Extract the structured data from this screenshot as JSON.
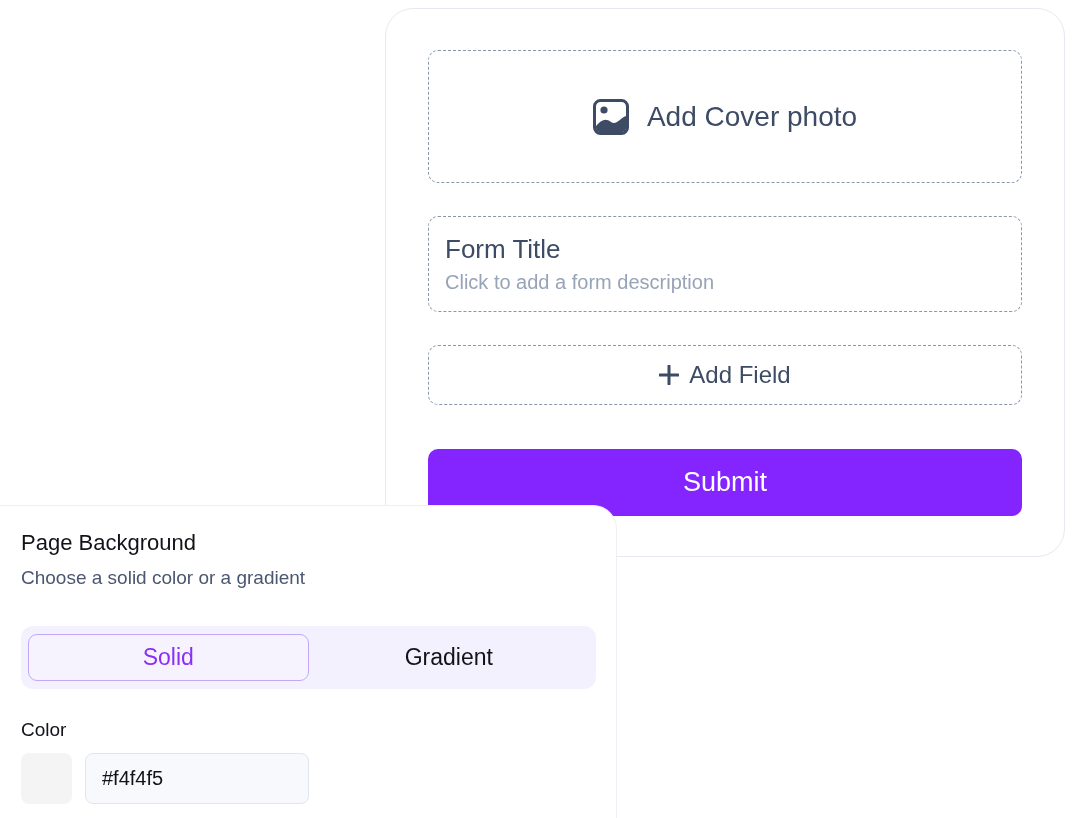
{
  "form": {
    "cover": {
      "label": "Add Cover photo"
    },
    "title": "Form Title",
    "description": {
      "placeholder": "Click to add a form description"
    },
    "add_field": {
      "label": "Add Field"
    },
    "submit": {
      "label": "Submit"
    }
  },
  "background_panel": {
    "title": "Page Background",
    "subtitle": "Choose a solid color or a gradient",
    "tabs": [
      {
        "label": "Solid",
        "selected": true
      },
      {
        "label": "Gradient",
        "selected": false
      }
    ],
    "color": {
      "label": "Color",
      "value": "#f4f4f5"
    }
  }
}
